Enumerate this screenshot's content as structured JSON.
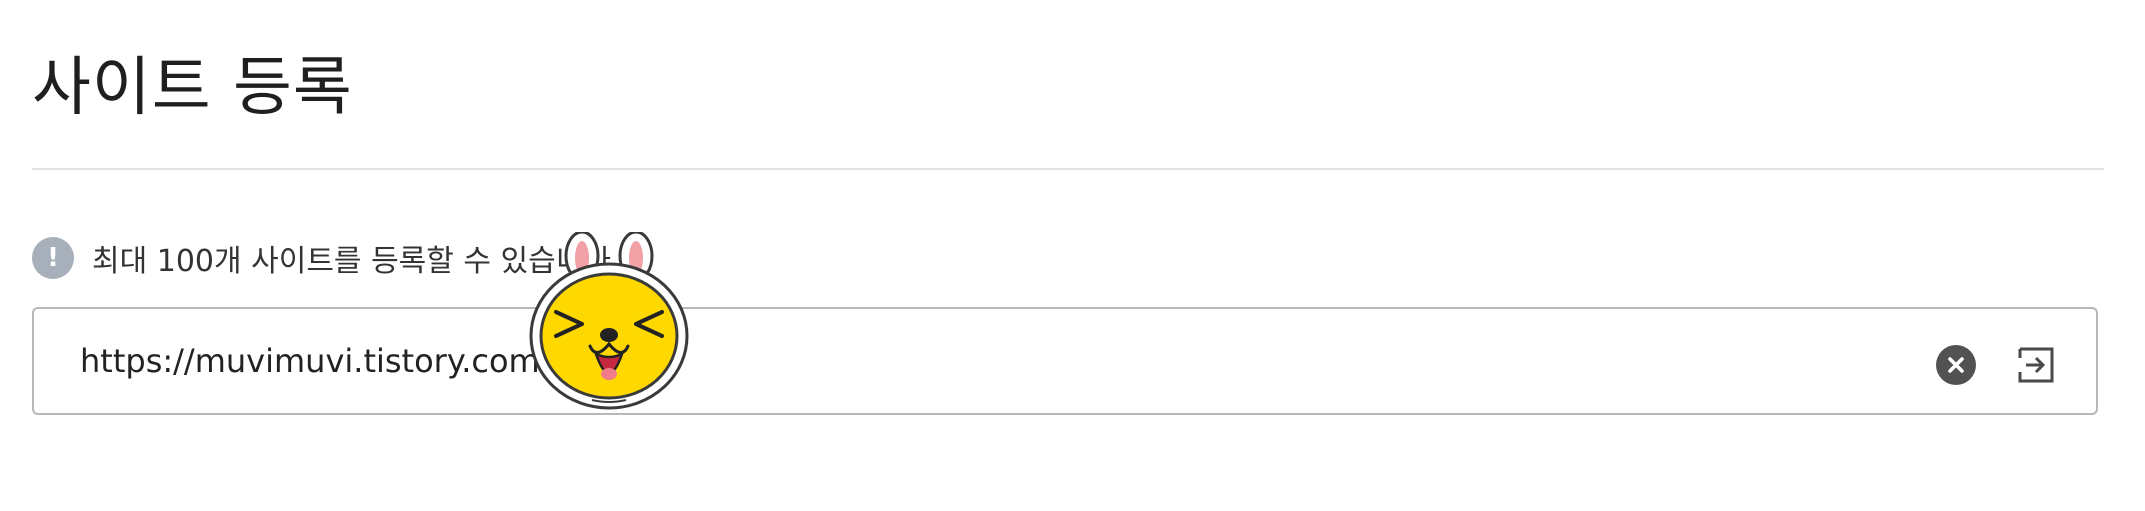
{
  "page": {
    "title": "사이트 등록"
  },
  "notice": {
    "icon": "exclamation-icon",
    "text": "최대 100개 사이트를 등록할 수 있습니다"
  },
  "url_field": {
    "value": "https://muvimuvi.tistory.com"
  },
  "actions": {
    "clear_icon": "clear-circle-x-icon",
    "submit_icon": "enter-arrow-icon"
  },
  "colors": {
    "notice_icon_bg": "#a7b0ba",
    "clear_button_bg": "#525252",
    "field_border": "#b8b8b8",
    "divider": "#e3e3e3",
    "sticker_face": "#ffd800"
  }
}
